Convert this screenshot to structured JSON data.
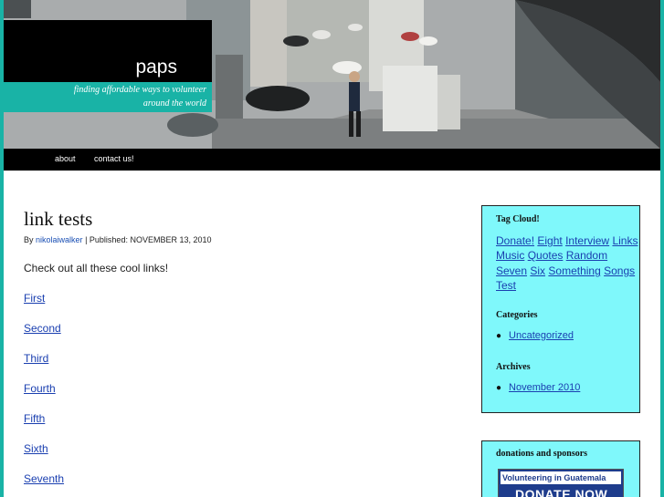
{
  "site": {
    "title": "paps",
    "tagline_line1": "finding affordable ways to volunteer",
    "tagline_line2": "around the world"
  },
  "nav": {
    "items": [
      {
        "label": "about"
      },
      {
        "label": "contact us!"
      }
    ]
  },
  "post": {
    "title": "link tests",
    "by_label": "By",
    "author": "nikolaiwalker",
    "published_label": "| Published: NOVEMBER 13, 2010",
    "intro": "Check out all these cool links!",
    "links": [
      "First",
      "Second",
      "Third",
      "Fourth",
      "Fifth",
      "Sixth",
      "Seventh"
    ]
  },
  "sidebar": {
    "tag_cloud_title": "Tag Cloud!",
    "tags": [
      "Donate!",
      "Eight",
      "Interview",
      "Links",
      "Music",
      "Quotes",
      "Random",
      "Seven",
      "Six",
      "Something",
      "Songs",
      "Test"
    ],
    "categories_title": "Categories",
    "categories": [
      "Uncategorized"
    ],
    "archives_title": "Archives",
    "archives": [
      "November 2010"
    ],
    "donations_title": "donations and sponsors",
    "donate_header": "Volunteering in Guatemala",
    "donate_button": "DONATE NOW"
  },
  "colors": {
    "accent": "#19b3a6",
    "sidebar_bg": "#7ff8fb",
    "link": "#1a3fb0"
  }
}
